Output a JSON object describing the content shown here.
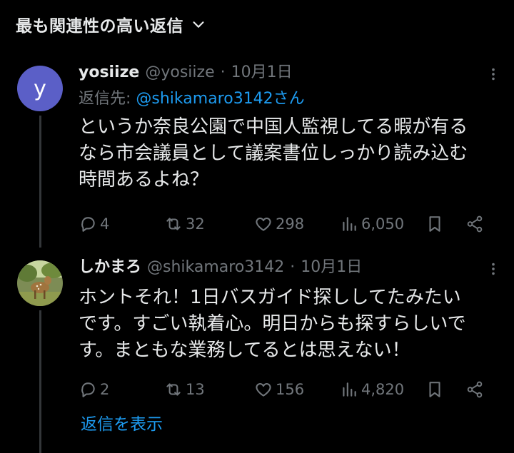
{
  "header": {
    "sort_label": "最も関連性の高い返信"
  },
  "tweets": [
    {
      "avatar_letter": "y",
      "name": "yosiize",
      "handle": "@yosiize",
      "dot": "·",
      "date": "10月1日",
      "reply_prefix": "返信先: ",
      "reply_to": "@shikamaro3142さん",
      "lines": [
        "というか奈良公園で中国人監視してる暇が有る",
        "なら市会議員として議案書位しっかり読み込む",
        "時間あるよね？"
      ],
      "replies": "4",
      "retweets": "32",
      "likes": "298",
      "views": "6,050"
    },
    {
      "name": "しかまろ",
      "handle": "@shikamaro3142",
      "dot": "·",
      "date": "10月1日",
      "lines": [
        "ホントそれ！1日バスガイド探ししてたみたい",
        "です。すごい執着心。明日からも探すらしいで",
        "す。まともな業務してるとは思えない！"
      ],
      "replies": "2",
      "retweets": "13",
      "likes": "156",
      "views": "4,820"
    }
  ],
  "footer": {
    "show_replies": "返信を表示"
  },
  "colors": {
    "background": "#000000",
    "text": "#e7e9ea",
    "muted": "#71767b",
    "accent": "#1d9bf0",
    "avatar_y": "#5b5fc7"
  },
  "icons": [
    "chevron-down-icon",
    "more-icon",
    "reply-icon",
    "retweet-icon",
    "like-icon",
    "views-icon",
    "bookmark-icon",
    "share-icon"
  ]
}
